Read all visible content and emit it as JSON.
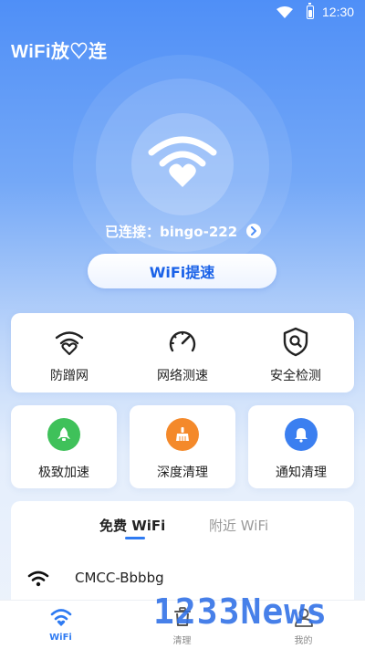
{
  "status_bar": {
    "time": "12:30"
  },
  "app": {
    "title": "WiFi放♡连"
  },
  "hero": {
    "connected_text": "已连接：bingo-222",
    "speed_button": "WiFi提速"
  },
  "features": [
    {
      "label": "防蹭网",
      "icon": "wifi-shield-icon"
    },
    {
      "label": "网络测速",
      "icon": "speedometer-icon"
    },
    {
      "label": "安全检测",
      "icon": "security-shield-icon"
    }
  ],
  "tools": [
    {
      "label": "极致加速",
      "icon": "rocket-icon",
      "color": "#3fc15a"
    },
    {
      "label": "深度清理",
      "icon": "broom-icon",
      "color": "#f4892a"
    },
    {
      "label": "通知清理",
      "icon": "bell-icon",
      "color": "#3b7ff0"
    }
  ],
  "wifi_list": {
    "tabs": [
      "免费 WiFi",
      "附近 WiFi"
    ],
    "active_tab": "免费 WiFi",
    "networks": [
      {
        "name": "CMCC-Bbbbg"
      }
    ]
  },
  "bottom_nav": {
    "items": [
      {
        "label": "WiFi",
        "icon": "wifi-icon",
        "active": true
      },
      {
        "label": "清理",
        "icon": "trash-icon",
        "active": false
      },
      {
        "label": "我的",
        "icon": "user-icon",
        "active": false
      }
    ]
  },
  "watermark": {
    "text": "1233News"
  },
  "colors": {
    "primary": "#2f7bf2",
    "background_top": "#4f8ff7",
    "card": "#ffffff"
  }
}
